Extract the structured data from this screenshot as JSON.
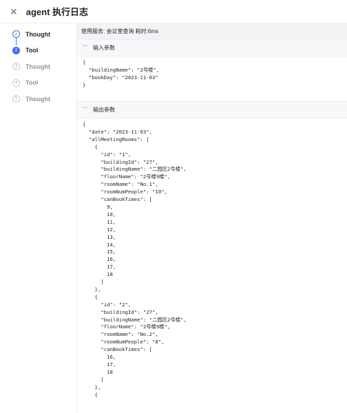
{
  "header": {
    "close_icon": "close-icon",
    "title": "agent 执行日志"
  },
  "steps": [
    {
      "index": "✓",
      "label": "Thought",
      "status": "done"
    },
    {
      "index": "2",
      "label": "Tool",
      "status": "active"
    },
    {
      "index": "3",
      "label": "Thought",
      "status": "wait"
    },
    {
      "index": "4",
      "label": "Tool",
      "status": "wait"
    },
    {
      "index": "5",
      "label": "Thought",
      "status": "wait"
    }
  ],
  "service_info": "使用服务: 会议室查询 耗时:6ms",
  "input_section": {
    "label": "输入参数",
    "json": "{\n  \"buildingName\": \"2号楼\",\n  \"bookDay\": \"2023-11-03\"\n}"
  },
  "output_section": {
    "label": "输出参数",
    "json": "{\n  \"date\": \"2023-11-03\",\n  \"allMeetingRooms\": [\n    {\n      \"id\": \"1\",\n      \"buildingId\": \"27\",\n      \"buildingName\": \"二园区2号楼\",\n      \"floorName\": \"2号楼9楼\",\n      \"roomName\": \"No.1\",\n      \"roomNumPeople\": \"10\",\n      \"canBookTimes\": [\n        9,\n        10,\n        11,\n        12,\n        13,\n        14,\n        15,\n        16,\n        17,\n        18\n      ]\n    },\n    {\n      \"id\": \"2\",\n      \"buildingId\": \"27\",\n      \"buildingName\": \"二园区2号楼\",\n      \"floorName\": \"2号楼9楼\",\n      \"roomName\": \"No.2\",\n      \"roomNumPeople\": \"8\",\n      \"canBookTimes\": [\n        16,\n        17,\n        18\n      ]\n    },\n    {"
  },
  "colors": {
    "accent": "#3b6ef5",
    "service_bar_bg": "#f2f3f5",
    "section_header_bg": "#f7f8fa"
  }
}
